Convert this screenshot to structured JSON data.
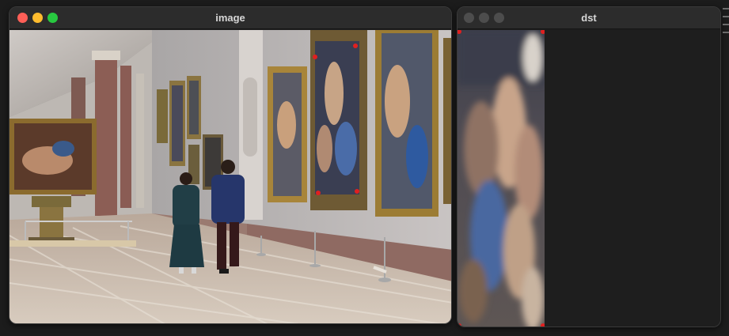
{
  "windows": {
    "image": {
      "title": "image"
    },
    "dst": {
      "title": "dst"
    }
  },
  "traffic_lights": {
    "close": "#ff5f57",
    "minimize": "#febc2e",
    "zoom": "#28c840",
    "inactive": "#4d4d4d"
  },
  "markers": {
    "color": "#e02020"
  }
}
